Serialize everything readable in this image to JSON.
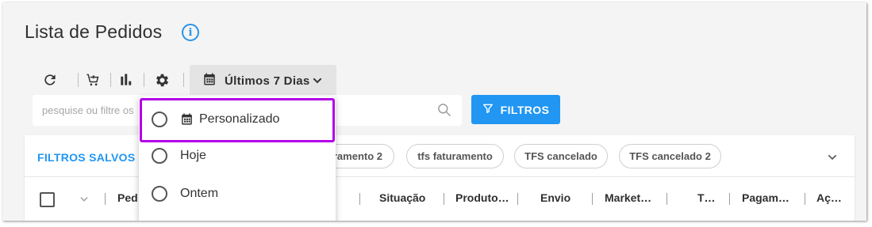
{
  "page": {
    "title": "Lista de Pedidos"
  },
  "toolbar": {
    "period_label": "Últimos 7 Dias"
  },
  "search": {
    "placeholder": "pesquise ou filtre os"
  },
  "filters_button": {
    "label": "FILTROS"
  },
  "saved_filters": {
    "label": "FILTROS SALVOS",
    "chips": [
      "ramento 2",
      "tfs faturamento",
      "TFS cancelado",
      "TFS cancelado 2"
    ]
  },
  "table": {
    "columns": [
      "Ped",
      "Situação",
      "Produto…",
      "Envio",
      "Market…",
      "T…",
      "Pagam…",
      "Aç…"
    ]
  },
  "dropdown": {
    "options": [
      "Personalizado",
      "Hoje",
      "Ontem"
    ]
  },
  "colors": {
    "accent": "#2196f3",
    "highlight": "#b300e6"
  },
  "icons": [
    "info-icon",
    "refresh-icon",
    "cart-icon",
    "bar-chart-icon",
    "gear-icon",
    "calendar-icon",
    "chevron-down-icon",
    "search-icon",
    "filter-icon",
    "checkbox-icon",
    "radio-icon"
  ]
}
